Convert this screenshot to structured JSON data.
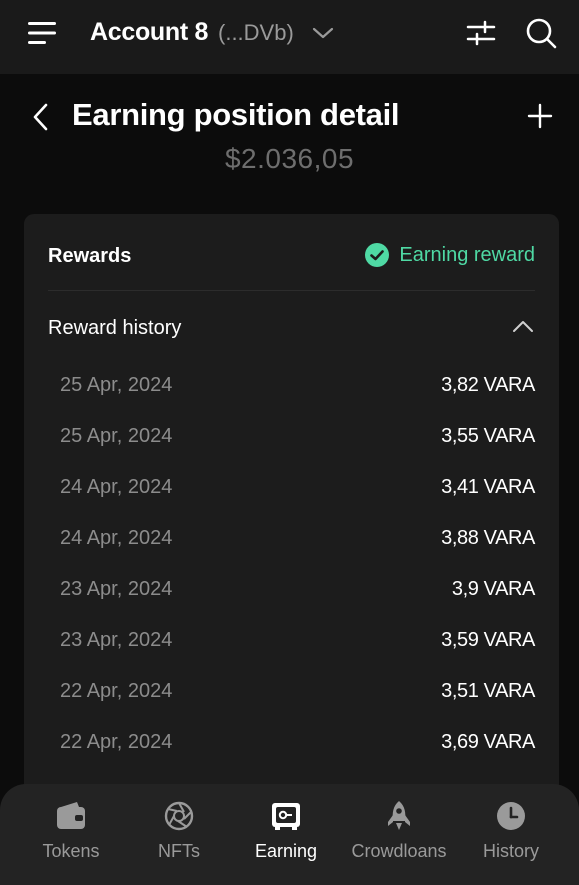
{
  "header": {
    "account_name": "Account 8",
    "account_address": "(...DVb)",
    "icons": [
      "menu-icon",
      "chevron-down-icon",
      "sliders-icon",
      "search-icon"
    ]
  },
  "page": {
    "title": "Earning position detail",
    "balance": "$2.036,05"
  },
  "rewards": {
    "label": "Rewards",
    "status": "Earning reward",
    "status_color": "#4fd9a4",
    "history_label": "Reward history",
    "history": [
      {
        "date": "25 Apr, 2024",
        "amount": "3,82 VARA"
      },
      {
        "date": "25 Apr, 2024",
        "amount": "3,55 VARA"
      },
      {
        "date": "24 Apr, 2024",
        "amount": "3,41 VARA"
      },
      {
        "date": "24 Apr, 2024",
        "amount": "3,88 VARA"
      },
      {
        "date": "23 Apr, 2024",
        "amount": "3,9 VARA"
      },
      {
        "date": "23 Apr, 2024",
        "amount": "3,59 VARA"
      },
      {
        "date": "22 Apr, 2024",
        "amount": "3,51 VARA"
      },
      {
        "date": "22 Apr, 2024",
        "amount": "3,69 VARA"
      }
    ]
  },
  "nav": {
    "items": [
      {
        "label": "Tokens",
        "icon": "wallet-icon",
        "active": false
      },
      {
        "label": "NFTs",
        "icon": "aperture-icon",
        "active": false
      },
      {
        "label": "Earning",
        "icon": "safe-icon",
        "active": true
      },
      {
        "label": "Crowdloans",
        "icon": "rocket-icon",
        "active": false
      },
      {
        "label": "History",
        "icon": "clock-icon",
        "active": false
      }
    ]
  },
  "colors": {
    "background": "#0c0c0c",
    "header_bg": "#1a1a1a",
    "card_bg": "#1c1c1c",
    "nav_bg": "#232323",
    "accent_green": "#4fd9a4"
  }
}
